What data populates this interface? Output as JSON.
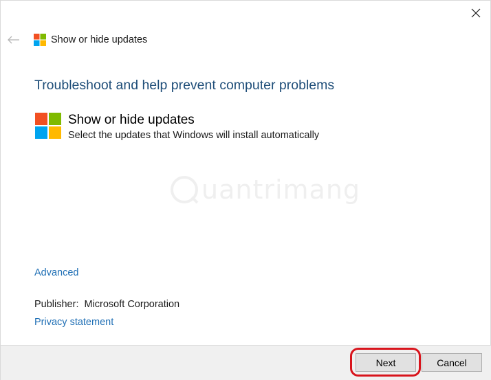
{
  "window": {
    "app_title": "Show or hide updates"
  },
  "main": {
    "heading": "Troubleshoot and help prevent computer problems",
    "item": {
      "title": "Show or hide updates",
      "description": "Select the updates that Windows will install automatically"
    },
    "advanced_label": "Advanced",
    "publisher_label": "Publisher:",
    "publisher_value": "Microsoft Corporation",
    "privacy_label": "Privacy statement"
  },
  "footer": {
    "next_label": "Next",
    "cancel_label": "Cancel"
  },
  "watermark": {
    "text": "uantrimang"
  },
  "icons": {
    "close": "close-icon",
    "back": "back-arrow-icon",
    "logo": "windows-logo-icon"
  },
  "colors": {
    "heading": "#1f4e79",
    "link": "#1f6fb5",
    "logo_red": "#f25022",
    "logo_green": "#7fba00",
    "logo_blue": "#00a4ef",
    "logo_yellow": "#ffb900",
    "highlight": "#d8141c"
  }
}
